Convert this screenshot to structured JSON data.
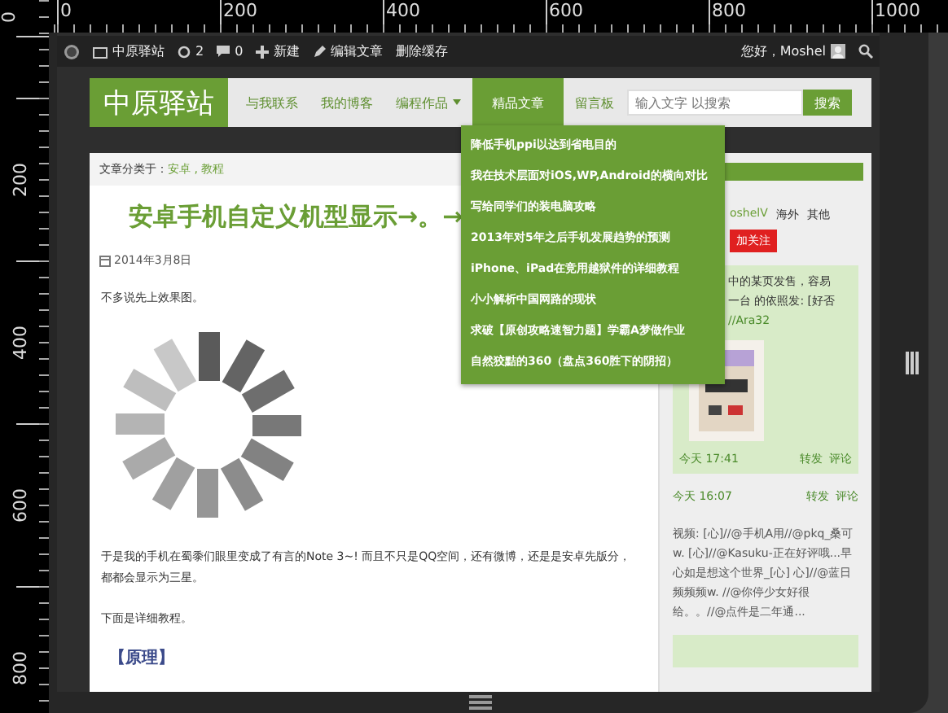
{
  "rulers": {
    "top_labels": [
      "0",
      "200",
      "400",
      "600",
      "800",
      "1000"
    ],
    "left_labels": [
      "0",
      "200",
      "400",
      "600",
      "800"
    ]
  },
  "admin_bar": {
    "site": "中原驿站",
    "comments": "2",
    "pending": "0",
    "new": "新建",
    "edit": "编辑文章",
    "purge": "删除缓存",
    "greeting": "您好，Moshel"
  },
  "header": {
    "logo": "中原驿站",
    "nav": [
      {
        "label": "与我联系",
        "selected": false,
        "has_menu": false
      },
      {
        "label": "我的博客",
        "selected": false,
        "has_menu": false
      },
      {
        "label": "编程作品",
        "selected": false,
        "has_menu": true
      },
      {
        "label": "精品文章",
        "selected": true,
        "has_menu": false
      },
      {
        "label": "留言板",
        "selected": false,
        "has_menu": false
      }
    ],
    "search": {
      "placeholder": "输入文字 以搜索",
      "button": "搜索"
    }
  },
  "dropdown": [
    "降低手机ppi以达到省电目的",
    "我在技术层面对iOS,WP,Android的横向对比",
    "写给同学们的装电脑攻略",
    "2013年对5年之后手机发展趋势的预测",
    "iPhone、iPad在竞用越狱件的详细教程",
    "小小解析中国网路的现状",
    "求破【原创攻略速智力题】学霸A梦做作业",
    "自然狡黠的360（盘点360胜下的阴招）"
  ],
  "post": {
    "breadcrumb_label": "文章分类于：",
    "categories": "安卓 , 教程",
    "title": "安卓手机自定义机型显示→。→",
    "date": "2014年3月8日",
    "intro": "不多说先上效果图。",
    "body": [
      "于是我的手机在蜀黍们眼里变成了有言的Note 3~! 而且不只是QQ空间，还有微博，还是是安卓先版分，都都会显示为三星。",
      "下面是详细教程。"
    ],
    "section_heading": "【原理】"
  },
  "sidebar": {
    "profile": {
      "name": "oshelV",
      "tags": [
        "海外",
        "其他"
      ],
      "follow": "加关注"
    },
    "weibo_lines": [
      "中的某页发售，容易",
      "一台 的依照发: [好否",
      "//Ara32"
    ],
    "posts": [
      {
        "time": "今天 17:41",
        "actions": [
          "转发",
          "评论"
        ]
      },
      {
        "time": "今天 16:07",
        "actions": [
          "转发",
          "评论"
        ]
      }
    ],
    "quote": "视频: [心]//@手机A用//@pkq_桑可w. [心]//@Kasuku-正在好评哦...早心如是想这个世界_[心] 心]//@蓝日频频频w. //@你停少女好很给。。//@点件是二年通..."
  }
}
